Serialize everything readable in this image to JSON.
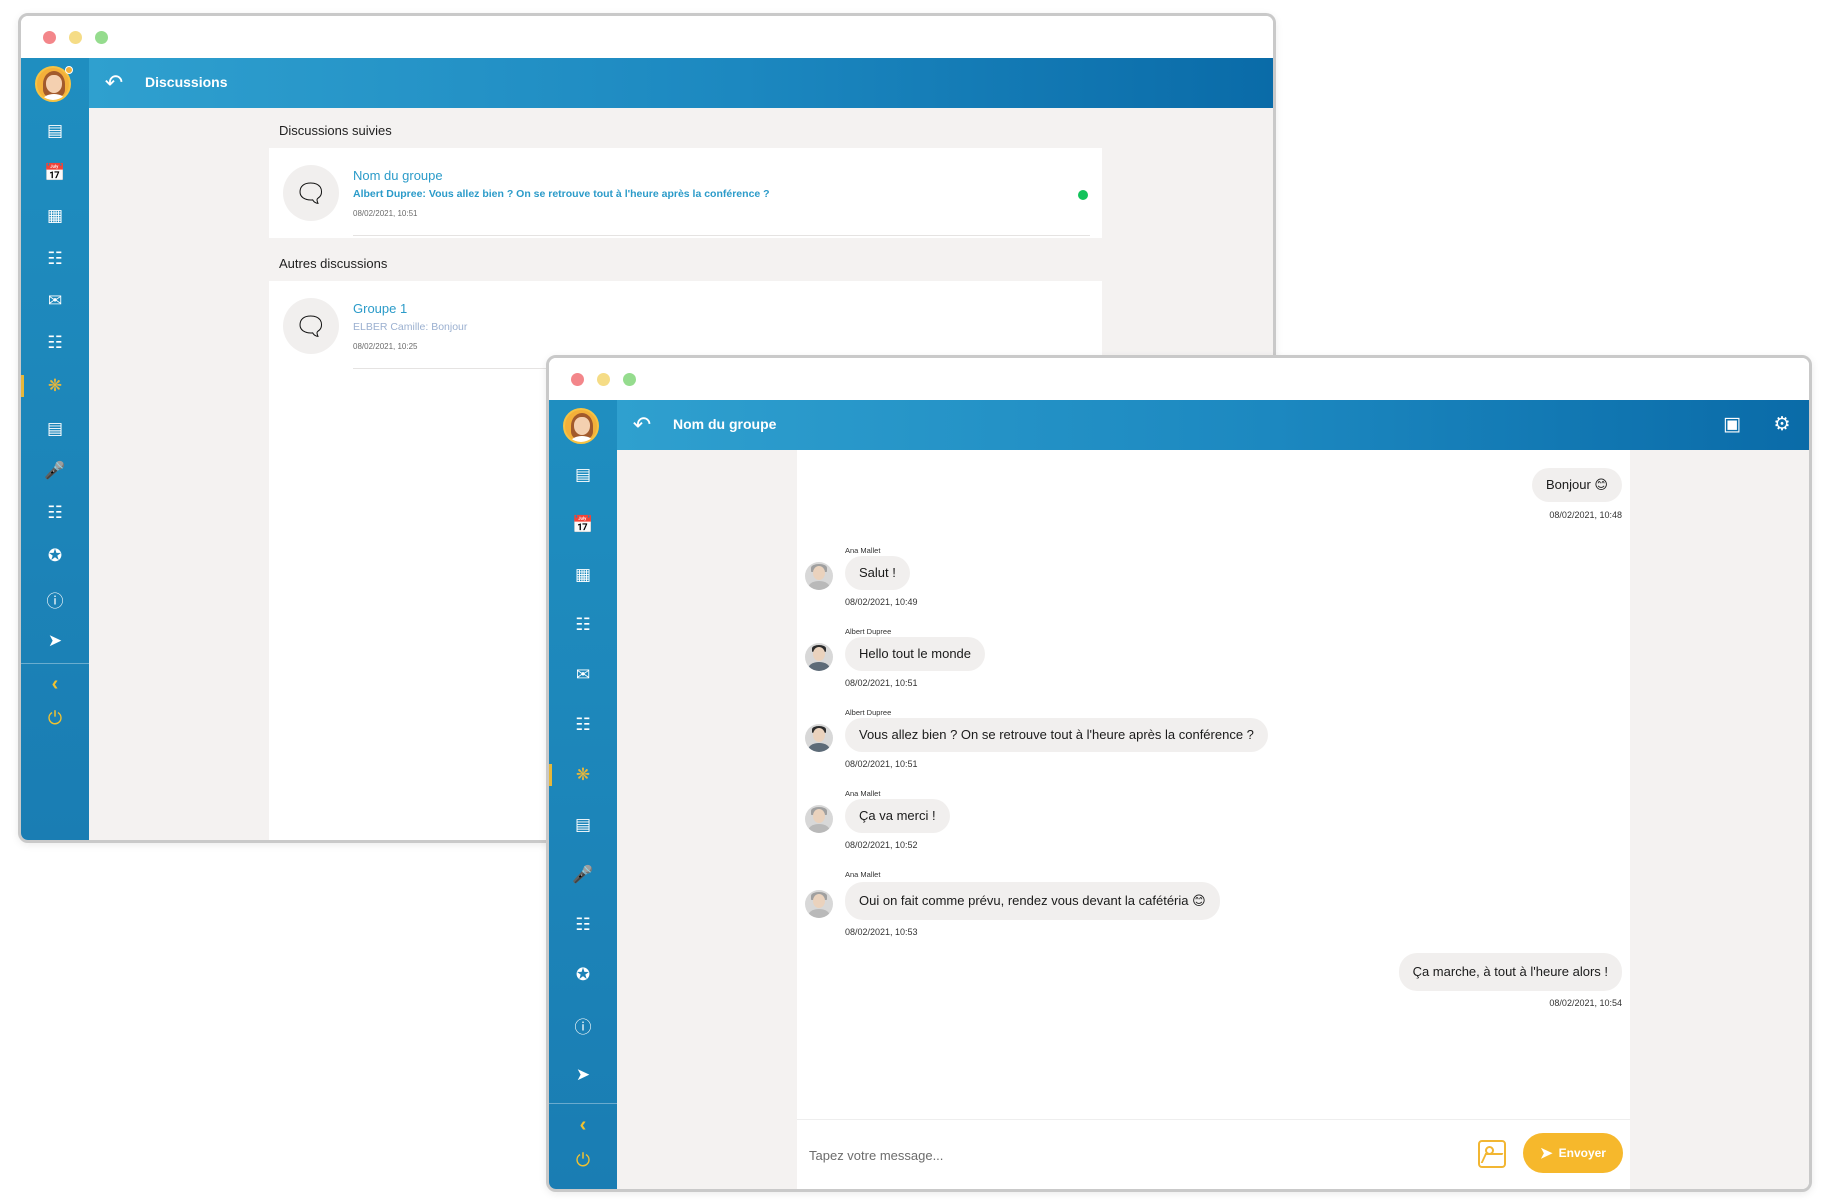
{
  "colors": {
    "sidebar": "#1f8ec0",
    "header_start": "#2fa0cf",
    "header_end": "#0a6ba8",
    "accent_link": "#2b9bc9",
    "accent_yellow": "#f6b82c",
    "online": "#13c35b",
    "bubble": "#f1efee",
    "background": "#f4f2f1"
  },
  "sidebar": {
    "icons": [
      "dashboard-icon",
      "calendar-icon",
      "floor-plan-icon",
      "schedule-icon",
      "inbox-icon",
      "agenda-icon",
      "network-icon",
      "document-icon",
      "microphone-icon",
      "people-icon",
      "star-badge-icon",
      "info-icon",
      "satellite-icon",
      "collapse-chevron-icon",
      "power-icon"
    ],
    "active_icon": "network-icon"
  },
  "discussions_window": {
    "header_title": "Discussions",
    "followed": {
      "section_title": "Discussions suivies",
      "items": [
        {
          "name": "Nom du groupe",
          "preview": "Albert Dupree: Vous allez bien ? On se retrouve tout à l'heure après la conférence ?",
          "time": "08/02/2021, 10:51",
          "online": true,
          "icon": "chat-bubbles-icon"
        }
      ]
    },
    "others": {
      "section_title": "Autres discussions",
      "items": [
        {
          "name": "Groupe 1",
          "preview": "ELBER Camille: Bonjour",
          "time": "08/02/2021, 10:25",
          "icon": "chat-bubbles-icon"
        }
      ]
    }
  },
  "chat_window": {
    "header_title": "Nom du groupe",
    "header_actions": [
      "video-call-icon",
      "settings-gear-icon"
    ],
    "messages": [
      {
        "own": true,
        "text": "Bonjour 😊",
        "time": "08/02/2021, 10:48"
      },
      {
        "own": false,
        "author": "Ana Mallet",
        "text": "Salut !",
        "time": "08/02/2021, 10:49"
      },
      {
        "own": false,
        "author": "Albert Dupree",
        "text": "Hello tout le monde",
        "time": "08/02/2021, 10:51"
      },
      {
        "own": false,
        "author": "Albert Dupree",
        "text": "Vous allez bien ? On se retrouve tout à l'heure après la conférence ?",
        "time": "08/02/2021, 10:51"
      },
      {
        "own": false,
        "author": "Ana Mallet",
        "text": "Ça va merci !",
        "time": "08/02/2021, 10:52"
      },
      {
        "own": false,
        "author": "Ana Mallet",
        "text": "Oui on fait comme prévu, rendez vous devant la cafétéria 😊",
        "time": "08/02/2021, 10:53"
      },
      {
        "own": true,
        "text": "Ça marche, à tout à l'heure alors !",
        "time": "08/02/2021, 10:54"
      }
    ],
    "composer": {
      "placeholder": "Tapez votre message...",
      "send_label": "Envoyer"
    }
  }
}
